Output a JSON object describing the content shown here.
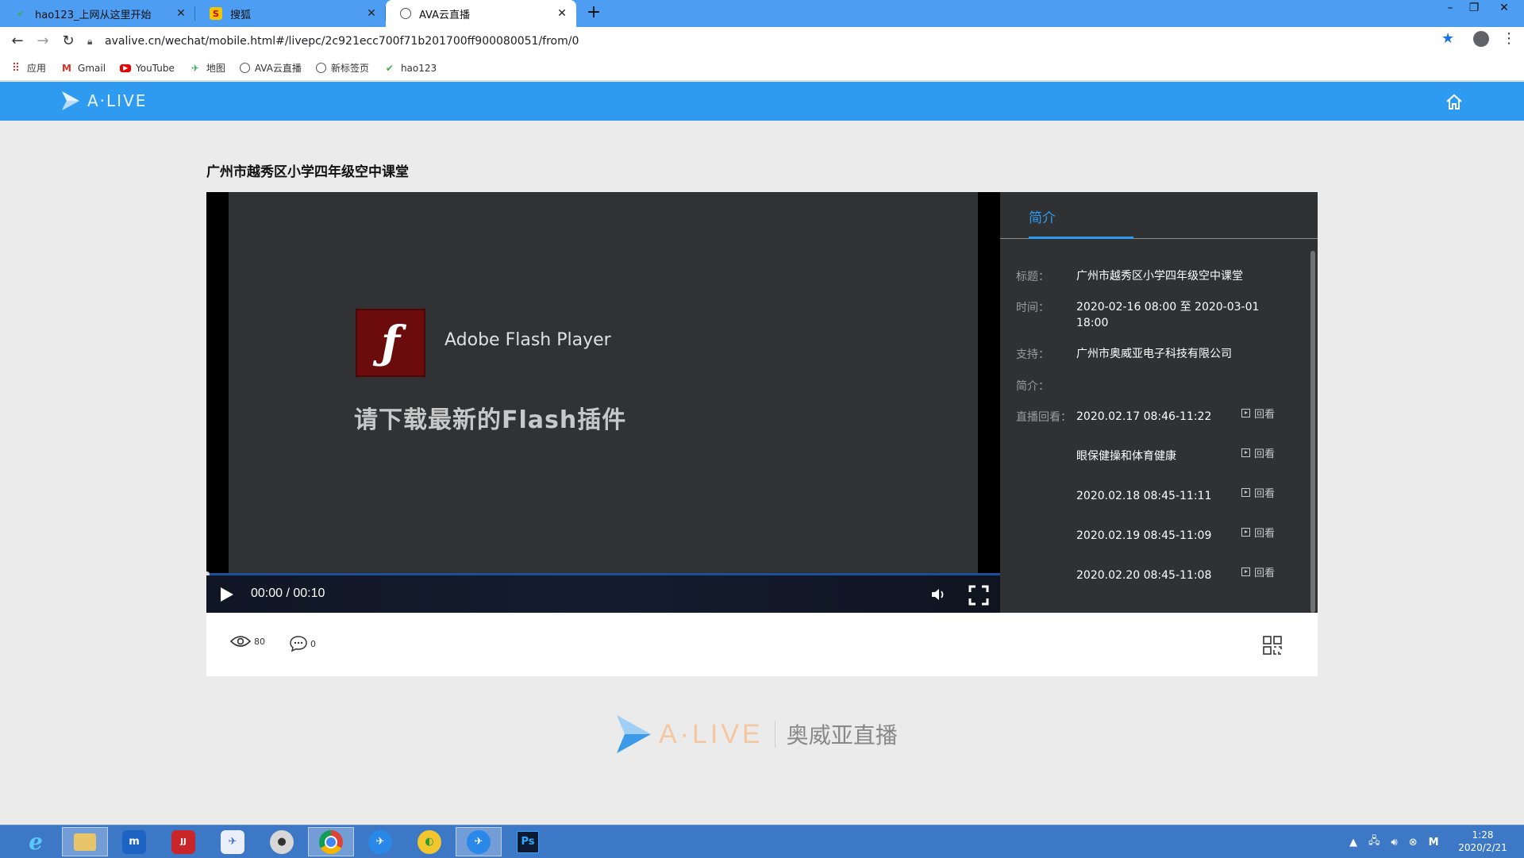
{
  "browser": {
    "tabs": [
      {
        "label": "hao123_上网从这里开始",
        "icon": "hao123-icon",
        "active": false
      },
      {
        "label": "搜狐",
        "icon": "sohu-icon",
        "active": false
      },
      {
        "label": "AVA云直播",
        "icon": "globe-icon",
        "active": true
      }
    ],
    "url": "avalive.cn/wechat/mobile.html#/livepc/2c921ecc700f71b201700ff900080051/from/0",
    "bookmarks": [
      {
        "label": "应用",
        "icon": "apps-grid-icon"
      },
      {
        "label": "Gmail",
        "icon": "gmail-icon"
      },
      {
        "label": "YouTube",
        "icon": "youtube-icon"
      },
      {
        "label": "地图",
        "icon": "maps-icon"
      },
      {
        "label": "AVA云直播",
        "icon": "globe-icon"
      },
      {
        "label": "新标签页",
        "icon": "globe-icon"
      },
      {
        "label": "hao123",
        "icon": "hao123-icon"
      }
    ]
  },
  "site": {
    "logo_text": "A·LIVE",
    "brand_color": "#2e9bf0"
  },
  "page": {
    "title": "广州市越秀区小学四年级空中课堂"
  },
  "player": {
    "flash_product": "Adobe Flash Player",
    "flash_message": "请下载最新的Flash插件",
    "time": "00:00 / 00:10",
    "progress": 0
  },
  "panel": {
    "tab_intro": "简介",
    "title_label": "标题：",
    "title_value": "广州市越秀区小学四年级空中课堂",
    "time_label": "时间：",
    "time_value": "2020-02-16 08:00 至 2020-03-01 18:00",
    "support_label": "支持：",
    "support_value": "广州市奥威亚电子科技有限公司",
    "intro_label": "简介：",
    "replay_label": "直播回看：",
    "replay_button": "回看",
    "replays": [
      "2020.02.17 08:46-11:22",
      "眼保健操和体育健康",
      "2020.02.18 08:45-11:11",
      "2020.02.19 08:45-11:09",
      "2020.02.20 08:45-11:08"
    ]
  },
  "stats": {
    "views": "80",
    "comments": "0"
  },
  "footer": {
    "logo_text": "A·LIVE",
    "brand_cn": "奥威亚直播"
  },
  "taskbar": {
    "time": "1:28",
    "date": "2020/2/21",
    "apps": [
      "ie-icon",
      "file-explorer-icon",
      "maxthon-icon",
      "jjgame-icon",
      "feishu-icon",
      "panda-icon",
      "chrome-icon",
      "dingtalk-icon",
      "qqbrowser-icon",
      "dingtalk-alt-icon",
      "photoshop-icon"
    ],
    "tray_m": "M"
  }
}
